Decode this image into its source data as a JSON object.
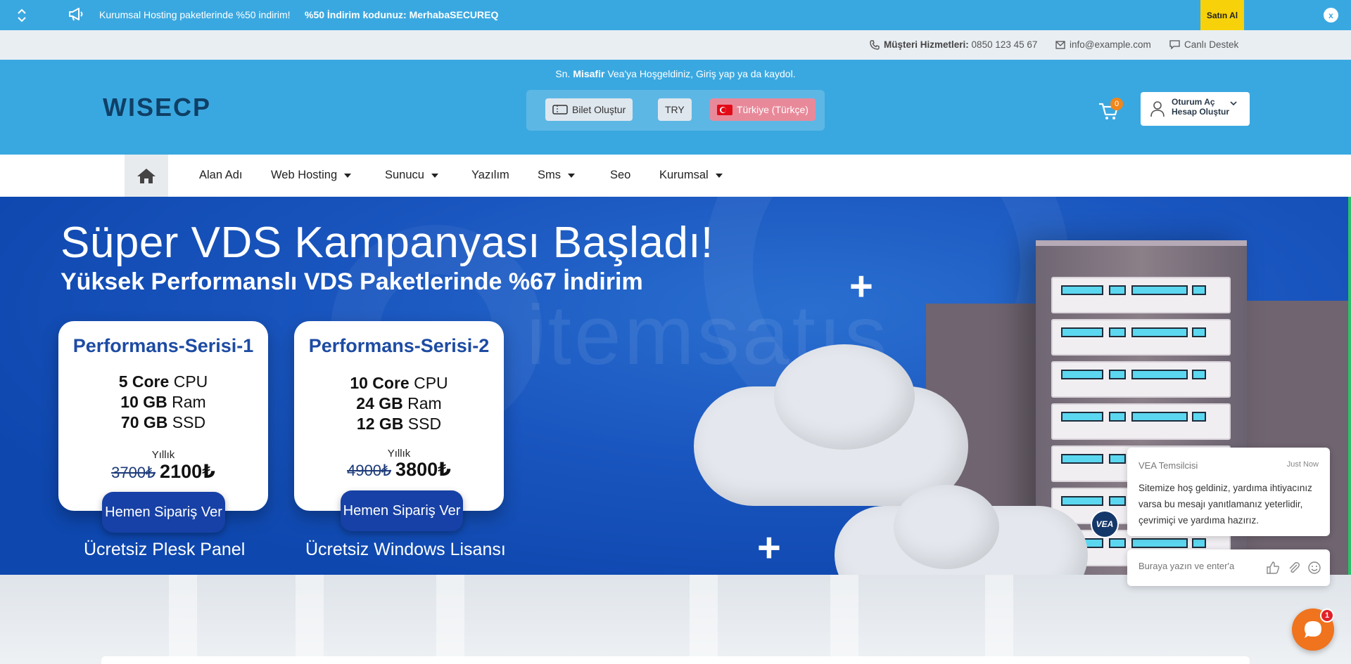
{
  "announcement": {
    "message": "Kurumsal Hosting paketlerinde %50 indirim!",
    "promo": "%50 İndirim kodunuz: MerhabaSECUREQ",
    "buy_label": "Satın Al",
    "close_label": "x"
  },
  "contact": {
    "phone_label": "Müşteri Hizmetleri:",
    "phone_value": "0850 123 45 67",
    "email": "info@example.com",
    "live_support": "Canlı Destek"
  },
  "header": {
    "welcome_prefix": "Sn.",
    "welcome_name": "Misafir",
    "welcome_suffix": "Vea'ya Hoşgeldiniz, Giriş yap ya da kaydol.",
    "logo_text": "WISECP",
    "ticket_label": "Bilet Oluştur",
    "currency": "TRY",
    "language": "Türkiye (Türkçe)",
    "cart_count": "0",
    "login_label": "Oturum Aç",
    "register_label": "Hesap Oluştur"
  },
  "nav": {
    "items": [
      {
        "label": "Alan Adı",
        "dropdown": false
      },
      {
        "label": "Web Hosting",
        "dropdown": true
      },
      {
        "label": "Sunucu",
        "dropdown": true
      },
      {
        "label": "Yazılım",
        "dropdown": false
      },
      {
        "label": "Sms",
        "dropdown": true
      },
      {
        "label": "Seo",
        "dropdown": false
      },
      {
        "label": "Kurumsal",
        "dropdown": true
      }
    ]
  },
  "hero": {
    "title": "Süper VDS Kampanyası Başladı!",
    "subtitle": "Yüksek Performanslı VDS Paketlerinde %67 İndirim",
    "watermark": "itemsatış",
    "cards": [
      {
        "title": "Performans-Serisi-1",
        "cpu_value": "5 Core",
        "cpu_unit": "CPU",
        "ram_value": "10 GB",
        "ram_unit": "Ram",
        "ssd_value": "70 GB",
        "ssd_unit": "SSD",
        "period": "Yıllık",
        "old_price": "3700₺",
        "new_price": "2100₺",
        "button": "Hemen Sipariş Ver",
        "perk": "Ücretsiz Plesk Panel"
      },
      {
        "title": "Performans-Serisi-2",
        "cpu_value": "10 Core",
        "cpu_unit": "CPU",
        "ram_value": "24 GB",
        "ram_unit": "Ram",
        "ssd_value": "12 GB",
        "ssd_unit": "SSD",
        "period": "Yıllık",
        "old_price": "4900₺",
        "new_price": "3800₺",
        "button": "Hemen Sipariş Ver",
        "perk": "Ücretsiz Windows Lisansı"
      }
    ]
  },
  "chat": {
    "agent": "VEA Temsilcisi",
    "time": "Just Now",
    "message": "Sitemize hoş geldiniz, yardıma ihtiyacınız varsa bu mesajı yanıtlamanız yeterlidir, çevrimiçi ve yardıma hazırız.",
    "avatar_text": "VEA",
    "input_placeholder": "Buraya yazın ve enter'a",
    "launcher_badge": "1"
  },
  "colors": {
    "brand_blue": "#3aa8e0",
    "hero_blue": "#1a56bf",
    "card_title": "#1d4ba3",
    "buy_yellow": "#f7d20a",
    "chat_orange": "#f0731e"
  }
}
